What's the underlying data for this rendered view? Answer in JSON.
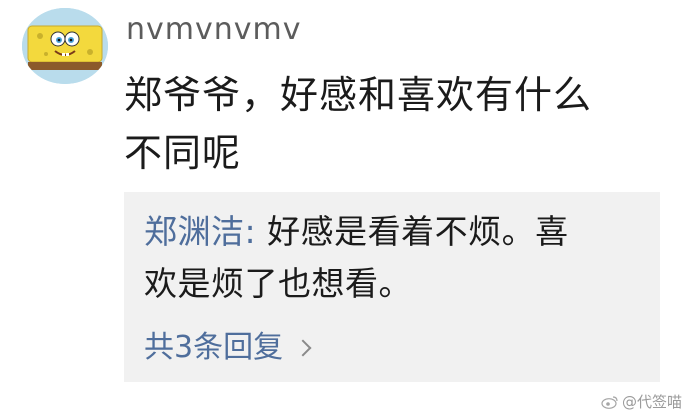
{
  "comment": {
    "username": "nvmvnvmv",
    "text_line1": "郑爷爷，好感和喜欢有什么",
    "text_line2": "不同呢",
    "avatar_icon": "spongebob-avatar-icon"
  },
  "reply": {
    "author": "郑渊洁",
    "separator": ": ",
    "text_line1": "好感是看着不烦。喜",
    "text_line2": "欢是烦了也想看。",
    "count_label": "共3条回复",
    "chevron_icon": "chevron-right-icon"
  },
  "watermark": {
    "text": "@代签喵",
    "logo_icon": "weibo-logo-icon"
  },
  "colors": {
    "link": "#4f6e9c",
    "username": "#5c5c5c",
    "reply_bg": "#f1f1f1"
  }
}
